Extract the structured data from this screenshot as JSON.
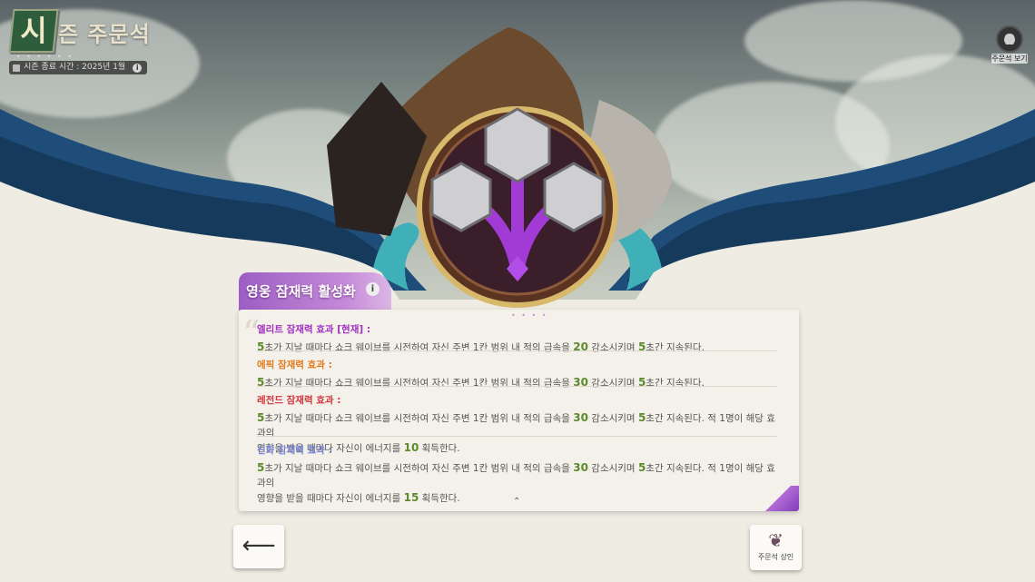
{
  "header": {
    "logo_char": "시",
    "logo_text": "즌 주문석",
    "dots": "• • • • • •",
    "season_end": "시즌 종료 시간 : 2025년 1월",
    "info_glyph": "i"
  },
  "top_right": {
    "label": "주문석 보기"
  },
  "panel": {
    "title": "영웅 잠재력 활성화",
    "info_glyph": "i",
    "grip": "• • • •",
    "expand_glyph": "⌃",
    "entries": [
      {
        "name": "엘리트 잠재력 효과 [현재] :",
        "color": "#a030c0",
        "body_a": "초가 지날 때마다 쇼크 웨이브를 시전하여 자신 주변 1칸 범위 내 적의 급속을",
        "num1": "5",
        "num2": "20",
        "num3": "5",
        "body_b": "감소시키며",
        "body_c": "초간 지속된다.",
        "extra": ""
      },
      {
        "name": "에픽 잠재력 효과 :",
        "color": "#e07a1a",
        "body_a": "초가 지날 때마다 쇼크 웨이브를 시전하여 자신 주변 1칸 범위 내 적의 급속을",
        "num1": "5",
        "num2": "30",
        "num3": "5",
        "body_b": "감소시키며",
        "body_c": "초간 지속된다.",
        "extra": ""
      },
      {
        "name": "레전드 잠재력 효과 :",
        "color": "#d0353a",
        "body_a": "초가 지날 때마다 쇼크 웨이브를 시전하여 자신 주변 1칸 범위 내 적의 급속을",
        "num1": "5",
        "num2": "30",
        "num3": "5",
        "body_b": "감소시키며",
        "body_c": "초간 지속된다. 적 1명이 해당 효과의",
        "extra_a": "영향을 받을 때마다 자신이 에너지를",
        "extra_num": "10",
        "extra_b": "획득한다."
      },
      {
        "name": "신화 잠재력 효과 :",
        "color": "#7a86d8",
        "body_a": "초가 지날 때마다 쇼크 웨이브를 시전하여 자신 주변 1칸 범위 내 적의 급속을",
        "num1": "5",
        "num2": "30",
        "num3": "5",
        "body_b": "감소시키며",
        "body_c": "초간 지속된다. 적 1명이 해당 효과의",
        "extra_a": "영향을 받을 때마다 자신이 에너지를",
        "extra_num": "15",
        "extra_b": "획득한다."
      }
    ]
  },
  "buttons": {
    "back_glyph": "⟵",
    "shop_label": "주문석 상인",
    "shop_glyph": "❦"
  }
}
